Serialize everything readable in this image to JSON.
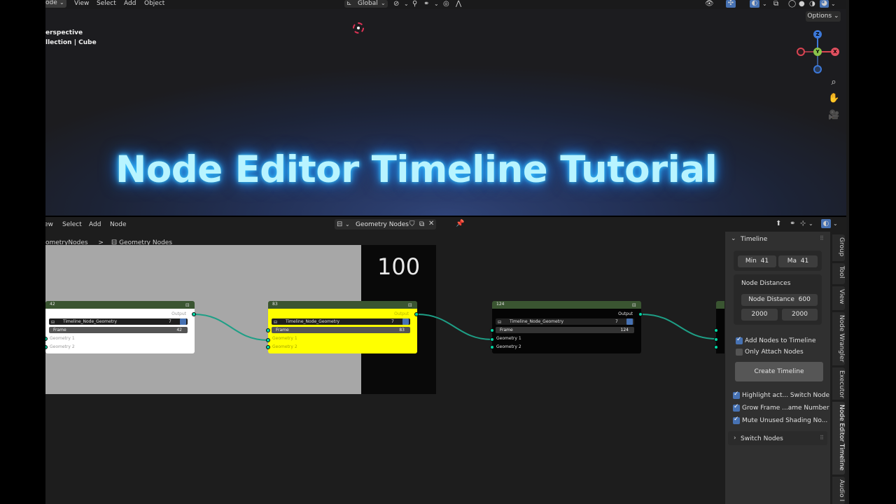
{
  "viewport": {
    "menu": [
      "Mode",
      "View",
      "Select",
      "Add",
      "Object"
    ],
    "mode_label": "ode",
    "transform_orientation": "Global",
    "options_label": "Options",
    "overlay_line1": "erspective",
    "overlay_line2": "llection | Cube",
    "gizmo": {
      "z": "Z",
      "y": "Y",
      "x": "X"
    },
    "title": "Node Editor Timeline Tutorial"
  },
  "node_editor": {
    "menu": [
      "ew",
      "Select",
      "Add",
      "Node"
    ],
    "tree_name": "Geometry Nodes",
    "breadcrumb": {
      "parent": "ometryNodes",
      "sep": ">",
      "current": "Geometry Nodes"
    },
    "frame_number": "100",
    "nodes": [
      {
        "header": "42",
        "output": "Output",
        "tree": "Timeline_Node_Geometry",
        "count": "7",
        "frame_label": "Frame",
        "frame_value": "42",
        "geo1": "Geometry 1",
        "geo2": "Geometry 2",
        "bg": "#ffffff",
        "text": "#111111"
      },
      {
        "header": "83",
        "output": "Output",
        "tree": "Timeline_Node_Geometry",
        "count": "7",
        "frame_label": "Frame",
        "frame_value": "83",
        "geo1": "Geometry 1",
        "geo2": "Geometry 2",
        "bg": "#ffff00",
        "text": "#111111"
      },
      {
        "header": "124",
        "output": "Output",
        "tree": "Timeline_Node_Geometry",
        "count": "7",
        "frame_label": "Frame",
        "frame_value": "124",
        "geo1": "Geometry 1",
        "geo2": "Geometry 2",
        "bg": "#000000",
        "text": "#e8e8e8"
      }
    ]
  },
  "panel": {
    "title": "Timeline",
    "min_label": "Min",
    "min_value": "41",
    "max_label": "Ma",
    "max_value": "41",
    "node_distances_label": "Node Distances",
    "node_distance_label": "Node Distance",
    "node_distance_value": "600",
    "dist_a": "2000",
    "dist_b": "2000",
    "add_nodes": "Add Nodes to Timeline",
    "only_attach": "Only Attach Nodes",
    "create_button": "Create Timeline",
    "highlight": "Highlight act... Switch Node",
    "grow_frame": "Grow Frame ...ame Number",
    "mute_unused": "Mute Unused Shading No...",
    "switch_nodes": "Switch Nodes"
  },
  "side_tabs": [
    "Group",
    "Tool",
    "View",
    "Node Wrangler",
    "Executor",
    "Node Editor Timeline",
    "Audio I"
  ],
  "colors": {
    "node_header": "#3a5531",
    "socket": "#00d6a3",
    "link": "#1e9f86",
    "accent": "#4772b3",
    "glow": "#2aa8ff"
  }
}
